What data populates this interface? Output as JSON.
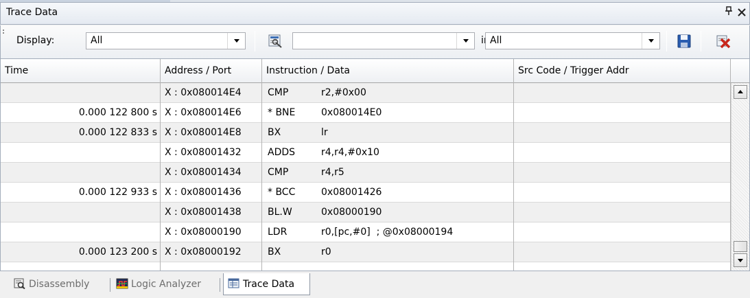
{
  "panel": {
    "title": "Trace Data",
    "pin_glyph": "ᵖ",
    "close_glyph": "✕"
  },
  "toolbar": {
    "display_label": "Display:",
    "display_value": "All",
    "search_value": "",
    "in_label": "in",
    "in_value": "All"
  },
  "columns": [
    "Time",
    "Address / Port",
    "Instruction / Data",
    "Src Code / Trigger Addr"
  ],
  "rows": [
    {
      "time": "",
      "addr": "X : 0x080014E4",
      "mnemonic": "CMP",
      "operand": "r2,#0x00",
      "src": ""
    },
    {
      "time": "0.000 122 800 s",
      "addr": "X : 0x080014E6",
      "mnemonic": "* BNE",
      "operand": "0x080014E0",
      "src": ""
    },
    {
      "time": "0.000 122 833 s",
      "addr": "X : 0x080014E8",
      "mnemonic": "BX",
      "operand": "lr",
      "src": ""
    },
    {
      "time": "",
      "addr": "X : 0x08001432",
      "mnemonic": "ADDS",
      "operand": "r4,r4,#0x10",
      "src": ""
    },
    {
      "time": "",
      "addr": "X : 0x08001434",
      "mnemonic": "CMP",
      "operand": "r4,r5",
      "src": ""
    },
    {
      "time": "0.000 122 933 s",
      "addr": "X : 0x08001436",
      "mnemonic": "* BCC",
      "operand": "0x08001426",
      "src": ""
    },
    {
      "time": "",
      "addr": "X : 0x08001438",
      "mnemonic": "BL.W",
      "operand": "0x08000190",
      "src": ""
    },
    {
      "time": "",
      "addr": "X : 0x08000190",
      "mnemonic": "LDR",
      "operand": "r0,[pc,#0]  ; @0x08000194",
      "src": ""
    },
    {
      "time": "0.000 123 200 s",
      "addr": "X : 0x08000192",
      "mnemonic": "BX",
      "operand": "r0",
      "src": ""
    }
  ],
  "tabs": [
    {
      "label": "Disassembly",
      "icon": "disassembly-icon",
      "active": false
    },
    {
      "label": "Logic Analyzer",
      "icon": "logic-analyzer-icon",
      "active": false
    },
    {
      "label": "Trace Data",
      "icon": "trace-data-icon",
      "active": true
    }
  ],
  "colors": {
    "row_alt": "#f0f0f0",
    "save_icon": "#2a5db0",
    "delete_icon": "#c8261b"
  }
}
